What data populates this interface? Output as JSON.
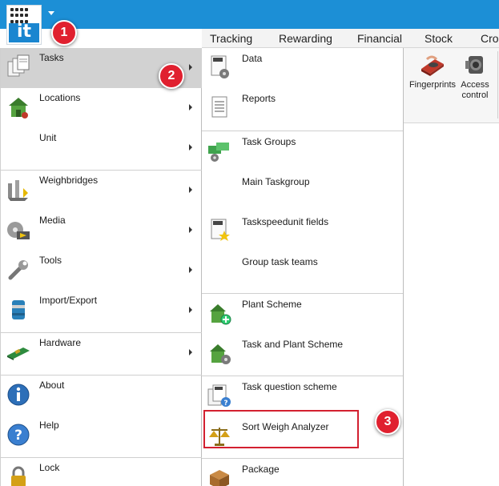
{
  "app": {
    "logo_text": "it"
  },
  "ribbon": {
    "tabs": [
      "Tracking",
      "Rewarding",
      "Financial",
      "Stock",
      "Cro"
    ],
    "buttons": [
      {
        "label": "Fingerprints",
        "icon": "fingerprint-scanner-icon"
      },
      {
        "label": "Access control",
        "icon": "access-control-speaker-icon"
      }
    ]
  },
  "main_menu": {
    "items": [
      {
        "label": "Tasks",
        "icon": "tasks-documents-icon",
        "active": true,
        "has_submenu": true
      },
      {
        "label": "Locations",
        "icon": "locations-house-icon",
        "has_submenu": true
      },
      {
        "label": "Unit",
        "icon": "",
        "has_submenu": true
      },
      {
        "label": "Weighbridges",
        "icon": "weighbridge-icon",
        "has_submenu": true
      },
      {
        "label": "Media",
        "icon": "media-film-icon",
        "has_submenu": true
      },
      {
        "label": "Tools",
        "icon": "tools-wrench-icon",
        "has_submenu": true
      },
      {
        "label": "Import/Export",
        "icon": "import-export-drum-icon",
        "has_submenu": true
      },
      {
        "label": "Hardware",
        "icon": "hardware-card-icon",
        "has_submenu": true
      },
      {
        "label": "About",
        "icon": "about-info-icon"
      },
      {
        "label": "Help",
        "icon": "help-question-icon"
      },
      {
        "label": "Lock",
        "icon": "lock-icon"
      }
    ]
  },
  "tasks_submenu": {
    "items": [
      {
        "label": "Data",
        "icon": "task-data-gear-icon"
      },
      {
        "label": "Reports",
        "icon": "reports-list-icon"
      },
      {
        "label": "Task Groups",
        "icon": "task-groups-icon"
      },
      {
        "label": "Main Taskgroup",
        "icon": ""
      },
      {
        "label": "Taskspeedunit fields",
        "icon": "taskspeedunit-star-icon"
      },
      {
        "label": "Group task teams",
        "icon": ""
      },
      {
        "label": "Plant Scheme",
        "icon": "plant-scheme-icon"
      },
      {
        "label": "Task and Plant Scheme",
        "icon": "task-plant-scheme-icon"
      },
      {
        "label": "Task question scheme",
        "icon": "task-question-icon"
      },
      {
        "label": "Sort Weigh Analyzer",
        "icon": "scale-balance-icon",
        "highlighted": true
      },
      {
        "label": "Package",
        "icon": "package-box-icon"
      }
    ]
  },
  "callouts": [
    "1",
    "2",
    "3"
  ],
  "colors": {
    "titlebar": "#1c8fd6",
    "active_item": "#d2d2d2",
    "callout": "#e0202f",
    "highlight_border": "#d32030"
  }
}
